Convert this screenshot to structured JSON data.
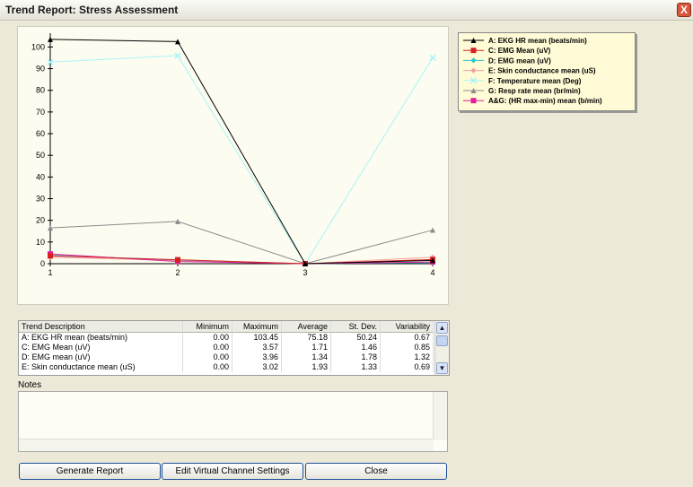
{
  "window": {
    "title": "Trend Report: Stress Assessment",
    "close_glyph": "X"
  },
  "chart_data": {
    "type": "line",
    "x": [
      1,
      2,
      3,
      4
    ],
    "xlim": [
      1,
      4
    ],
    "ylim": [
      0,
      100
    ],
    "yticks": [
      0,
      10,
      20,
      30,
      40,
      50,
      60,
      70,
      80,
      90,
      100
    ],
    "xticks": [
      "1",
      "2",
      "3",
      "4"
    ],
    "series": [
      {
        "name": "A: EKG HR mean (beats/min)",
        "color": "#000000",
        "marker": "triangle",
        "values": [
          103.5,
          102.5,
          0,
          1.5
        ]
      },
      {
        "name": "C: EMG Mean (uV)",
        "color": "#d62020",
        "marker": "square",
        "values": [
          3.6,
          1.8,
          0,
          1.9
        ]
      },
      {
        "name": "D: EMG mean (uV)",
        "color": "#20c8d0",
        "marker": "diamond",
        "values": [
          3.9,
          1.7,
          0,
          0.5
        ]
      },
      {
        "name": "E: Skin conductance mean (uS)",
        "color": "#f4a0a0",
        "marker": "diamond",
        "values": [
          3.0,
          1.5,
          0,
          3.0
        ]
      },
      {
        "name": "F: Temperature mean (Deg)",
        "color": "#a8f4f8",
        "marker": "x",
        "values": [
          93,
          96,
          0,
          95
        ]
      },
      {
        "name": "G: Resp rate mean (br/min)",
        "color": "#8c8c8c",
        "marker": "triangle",
        "values": [
          16.5,
          19.5,
          0,
          15.5
        ]
      },
      {
        "name": "A&G: (HR max-min) mean (b/min)",
        "color": "#e0209a",
        "marker": "square",
        "values": [
          4.5,
          1.0,
          0,
          0.8
        ]
      }
    ]
  },
  "table": {
    "columns": [
      "Trend Description",
      "Minimum",
      "Maximum",
      "Average",
      "St. Dev.",
      "Variability"
    ],
    "rows": [
      [
        "A: EKG HR mean (beats/min)",
        "0.00",
        "103.45",
        "75.18",
        "50.24",
        "0.67"
      ],
      [
        "C: EMG Mean (uV)",
        "0.00",
        "3.57",
        "1.71",
        "1.46",
        "0.85"
      ],
      [
        "D: EMG mean (uV)",
        "0.00",
        "3.96",
        "1.34",
        "1.78",
        "1.32"
      ],
      [
        "E: Skin conductance mean (uS)",
        "0.00",
        "3.02",
        "1.93",
        "1.33",
        "0.69"
      ]
    ]
  },
  "notes": {
    "label": "Notes",
    "value": ""
  },
  "buttons": {
    "generate": "Generate Report",
    "edit": "Edit Virtual Channel Settings",
    "close": "Close"
  }
}
